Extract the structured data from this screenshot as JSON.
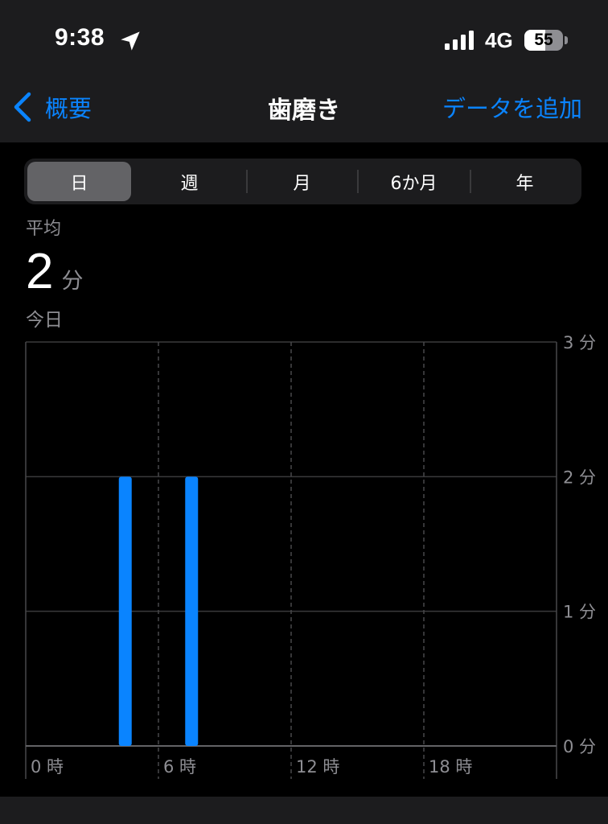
{
  "status_bar": {
    "time": "9:38",
    "network": "4G",
    "battery_level": 55,
    "battery_text": "55",
    "icons": [
      "location-arrow-icon",
      "cellular-signal-icon",
      "battery-icon"
    ]
  },
  "nav": {
    "back_label": "概要",
    "title": "歯磨き",
    "add_label": "データを追加",
    "icons": [
      "chevron-left-icon"
    ]
  },
  "segments": [
    {
      "label": "日",
      "selected": true
    },
    {
      "label": "週",
      "selected": false
    },
    {
      "label": "月",
      "selected": false
    },
    {
      "label": "6か月",
      "selected": false
    },
    {
      "label": "年",
      "selected": false
    }
  ],
  "summary": {
    "label": "平均",
    "value": "2",
    "unit": "分",
    "date": "今日"
  },
  "colors": {
    "accent": "#0a84ff",
    "bar": "#0a84ff",
    "background": "#000000",
    "header": "#1c1c1e",
    "secondary_text": "#8e8e93"
  },
  "chart_data": {
    "type": "bar",
    "x_ticks": [
      "0 時",
      "6 時",
      "12 時",
      "18 時"
    ],
    "x_tick_values": [
      0,
      6,
      12,
      18
    ],
    "x_range": [
      0,
      24
    ],
    "y_ticks": [
      "0 分",
      "1 分",
      "2 分",
      "3 分"
    ],
    "y_tick_values": [
      0,
      1,
      2,
      3
    ],
    "ylim": [
      0,
      3
    ],
    "bars": [
      {
        "hour": 4,
        "value": 2
      },
      {
        "hour": 7,
        "value": 2
      }
    ],
    "grid": true
  }
}
